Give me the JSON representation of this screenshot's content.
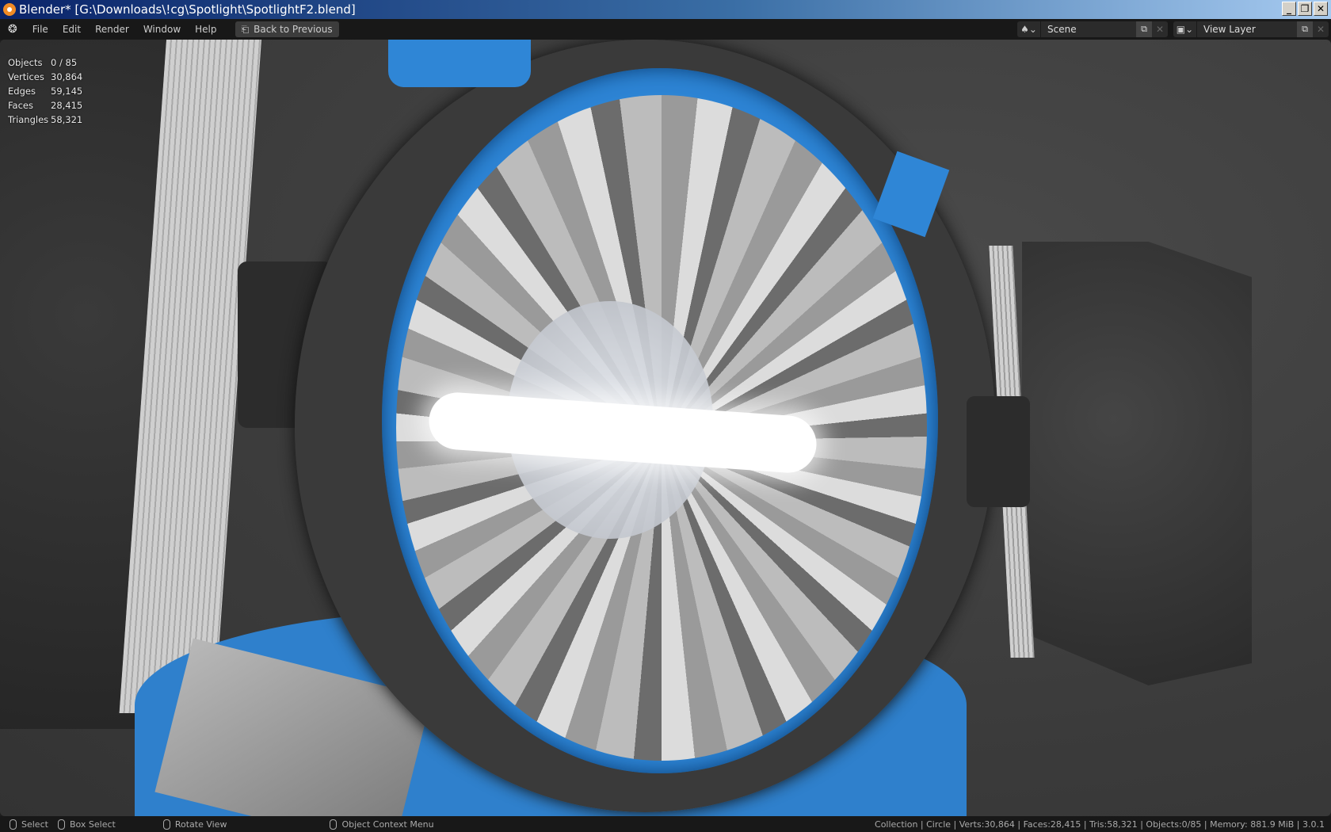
{
  "window": {
    "title": "Blender* [G:\\Downloads\\!cg\\Spotlight\\SpotlightF2.blend]",
    "buttons": [
      "_",
      "❐",
      "✕"
    ]
  },
  "menu": {
    "items": [
      "File",
      "Edit",
      "Render",
      "Window",
      "Help"
    ],
    "back_button": "Back to Previous"
  },
  "scene_selector": {
    "value": "Scene"
  },
  "view_layer_selector": {
    "value": "View Layer"
  },
  "stats": [
    {
      "label": "Objects",
      "value": "0 / 85"
    },
    {
      "label": "Vertices",
      "value": "30,864"
    },
    {
      "label": "Edges",
      "value": "59,145"
    },
    {
      "label": "Faces",
      "value": "28,415"
    },
    {
      "label": "Triangles",
      "value": "58,321"
    }
  ],
  "statusbar": {
    "hints": [
      "Select",
      "Box Select",
      "Rotate View",
      "Object Context Menu"
    ],
    "info": "Collection | Circle | Verts:30,864 | Faces:28,415 | Tris:58,321 | Objects:0/85 | Memory: 881.9 MiB | 3.0.1"
  },
  "colors": {
    "accent_blue": "#2f86d6",
    "ring": "#2e2e2e",
    "background": "#3b3b3b"
  }
}
